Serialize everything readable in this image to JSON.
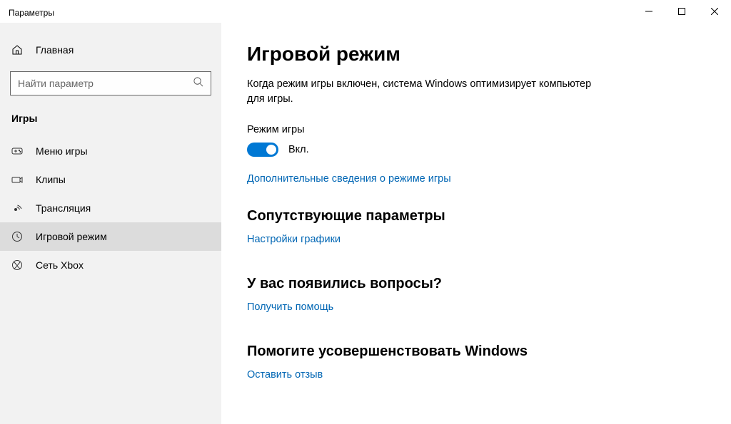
{
  "window": {
    "title": "Параметры"
  },
  "sidebar": {
    "home": "Главная",
    "search_placeholder": "Найти параметр",
    "group": "Игры",
    "items": [
      {
        "label": "Меню игры"
      },
      {
        "label": "Клипы"
      },
      {
        "label": "Трансляция"
      },
      {
        "label": "Игровой режим"
      },
      {
        "label": "Сеть Xbox"
      }
    ]
  },
  "main": {
    "title": "Игровой режим",
    "desc": "Когда режим игры включен, система Windows оптимизирует компьютер для игры.",
    "toggle_label": "Режим игры",
    "toggle_state": "Вкл.",
    "more_link": "Дополнительные сведения о режиме игры",
    "related_h": "Сопутствующие параметры",
    "related_link": "Настройки графики",
    "help_h": "У вас появились вопросы?",
    "help_link": "Получить помощь",
    "feedback_h": "Помогите усовершенствовать Windows",
    "feedback_link": "Оставить отзыв"
  }
}
